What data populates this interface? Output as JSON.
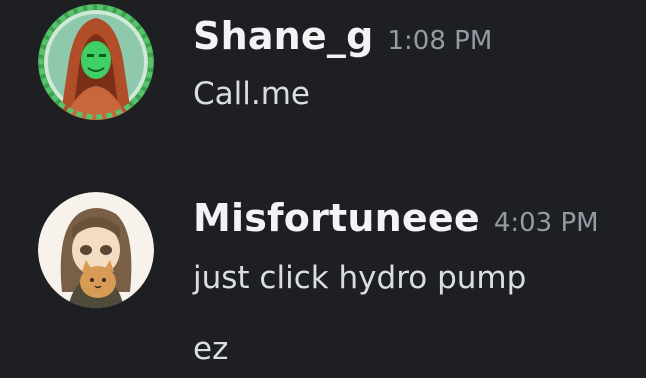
{
  "colors": {
    "background": "#1e1f22",
    "username": "#f2f3f5",
    "timestamp": "#949ba4",
    "message_text": "#dbdee1"
  },
  "messages": [
    {
      "username": "Shane_g",
      "timestamp": "1:08 PM",
      "avatar_icon": "green-hooded-warrior-avatar",
      "lines": [
        "Call.me"
      ]
    },
    {
      "username": "Misfortuneee",
      "timestamp": "4:03 PM",
      "avatar_icon": "anime-girl-with-cat-avatar",
      "lines": [
        "just click hydro pump",
        "ez"
      ]
    }
  ]
}
